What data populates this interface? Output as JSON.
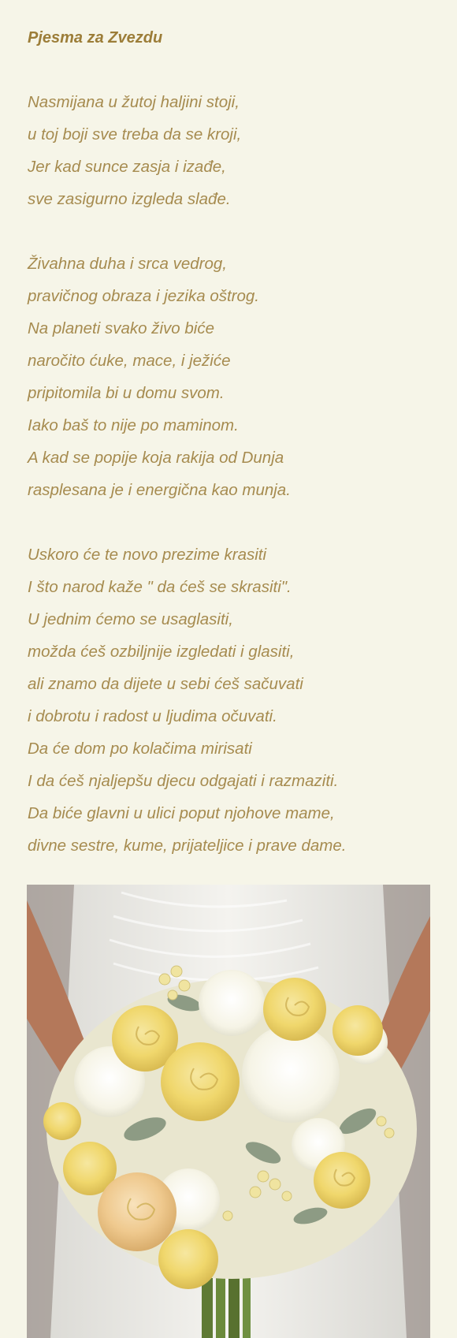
{
  "title": "Pjesma za Zvezdu",
  "stanzas": [
    [
      "Nasmijana u žutoj haljini  stoji,",
      "u toj boji sve treba da se kroji,",
      "Jer kad sunce zasja i izađe,",
      "sve zasigurno izgleda slađe."
    ],
    [
      "Živahna  duha i srca vedrog,",
      "pravičnog obraza i jezika oštrog.",
      "Na planeti svako živo biće",
      "naročito ćuke, mace, i ježiće",
      "pripitomila bi u domu svom.",
      "Iako baš to nije po maminom.",
      "A kad se popije koja rakija od Dunja",
      "rasplesana je i energična kao munja."
    ],
    [
      "Uskoro će te novo prezime krasiti",
      "I što narod kaže \" da ćeš se skrasiti\".",
      "U jednim ćemo se usaglasiti,",
      "možda ćeš ozbiljnije izgledati i glasiti,",
      "ali znamo da dijete u sebi ćeš sačuvati",
      "i dobrotu i radost u ljudima očuvati.",
      "Da će dom po kolačima mirisati",
      "I da ćeš njaljepšu djecu odgajati i razmaziti.",
      "Da biće glavni u ulici poput njohove mame,",
      "divne sestre, kume, prijateljice i prave dame."
    ]
  ],
  "photo": {
    "subject": "bridal-bouquet",
    "colors": {
      "dress": "#f2f1ee",
      "skin": "#b4785a",
      "yellow_rose": "#f3dd7e",
      "peach_rose": "#f1d3a0",
      "white_flower": "#fbfaf2",
      "berry": "#f0e4a0",
      "leaf": "#8d9b84",
      "stem": "#5f7a35"
    }
  }
}
